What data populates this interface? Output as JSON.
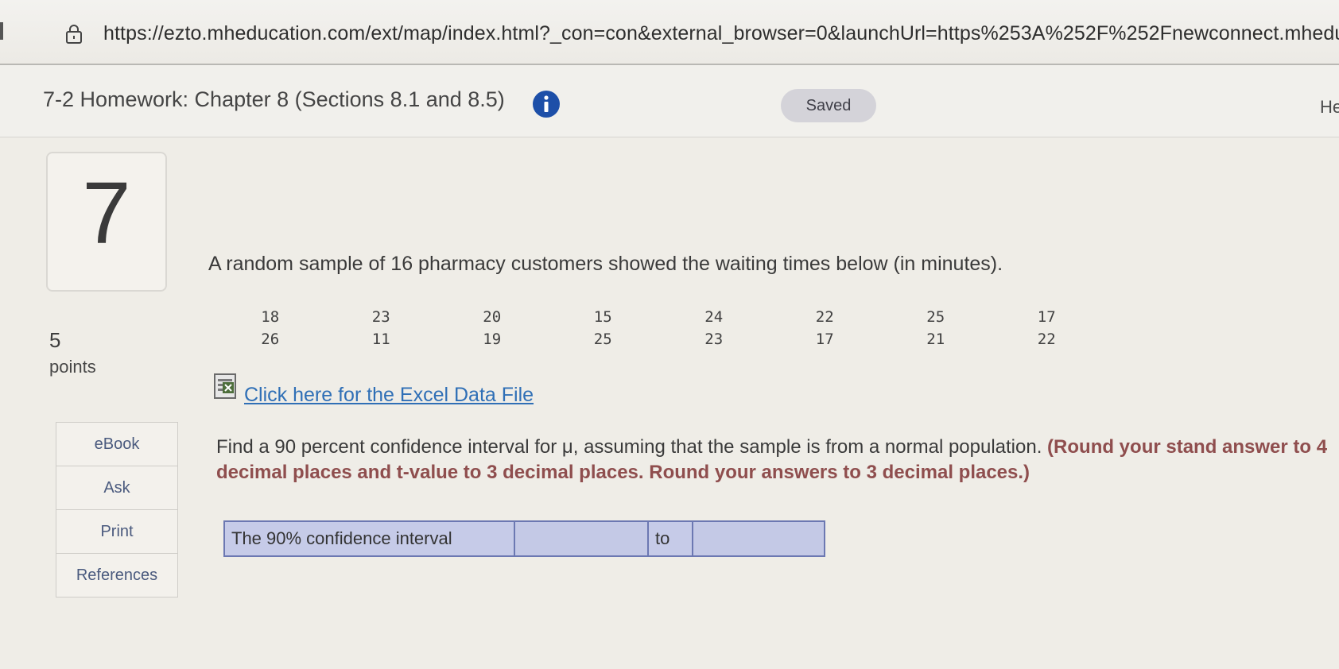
{
  "browser": {
    "url": "https://ezto.mheducation.com/ext/map/index.html?_con=con&external_browser=0&launchUrl=https%253A%252F%252Fnewconnect.mheduca"
  },
  "header": {
    "title": "7-2 Homework: Chapter 8 (Sections 8.1 and 8.5)",
    "saved": "Saved",
    "help": "He"
  },
  "question": {
    "number": "7",
    "points_value": "5",
    "points_label": "points",
    "text": "A random sample of 16 pharmacy customers showed the waiting times below (in minutes).",
    "data_rows": [
      [
        "18",
        "23",
        "20",
        "15",
        "24",
        "22",
        "25",
        "17"
      ],
      [
        "26",
        "11",
        "19",
        "25",
        "23",
        "17",
        "21",
        "22"
      ]
    ],
    "excel_link": "Click here for the Excel Data File",
    "instruction_prefix": "Find a 90 percent confidence interval for μ, assuming that the sample is from a normal population. ",
    "instruction_bold": "(Round your stand answer to 4 decimal places and t-value to 3 decimal places. Round your answers to 3 decimal places.)",
    "answer_label": "The 90% confidence interval",
    "answer_to": "to",
    "lower_value": "",
    "upper_value": ""
  },
  "side_menu": {
    "ebook": "eBook",
    "ask": "Ask",
    "print": "Print",
    "references": "References"
  },
  "colors": {
    "link": "#2f6fb6",
    "instruction_bold": "#8f4e4e",
    "answer_bg": "#c6cbe8",
    "info_icon": "#1d4fa8"
  }
}
